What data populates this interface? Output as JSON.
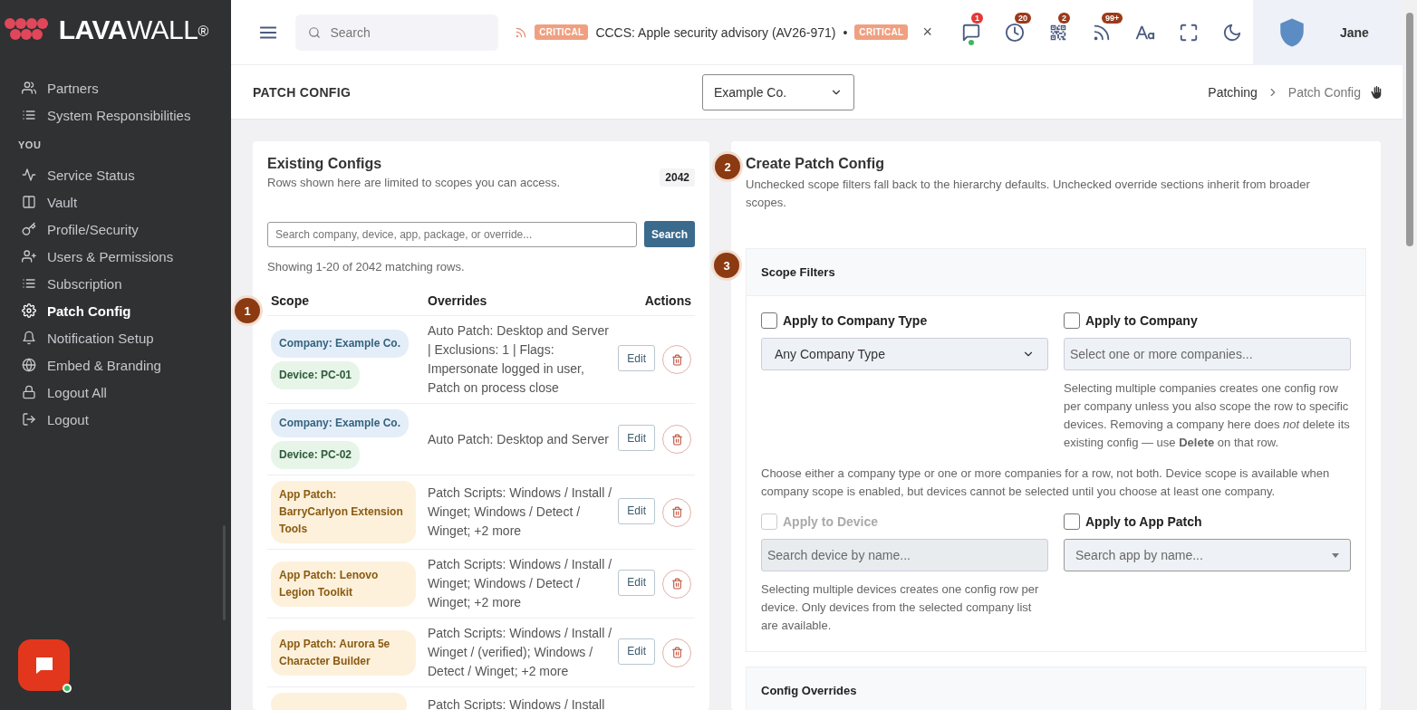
{
  "brand": {
    "bold": "LAVA",
    "light": "WALL",
    "mark": "®"
  },
  "sidebar": {
    "sections": [
      {
        "items": [
          {
            "label": "Partners",
            "selected": false
          },
          {
            "label": "System Responsibilities",
            "selected": false
          }
        ]
      },
      {
        "heading": "YOU",
        "items": [
          {
            "label": "Service Status",
            "selected": false
          },
          {
            "label": "Vault",
            "selected": false
          },
          {
            "label": "Profile/Security",
            "selected": false
          },
          {
            "label": "Users & Permissions",
            "selected": false
          },
          {
            "label": "Subscription",
            "selected": false
          },
          {
            "label": "Patch Config",
            "selected": true
          },
          {
            "label": "Notification Setup",
            "selected": false
          },
          {
            "label": "Embed & Branding",
            "selected": false
          },
          {
            "label": "Logout All",
            "selected": false
          },
          {
            "label": "Logout",
            "selected": false
          }
        ]
      }
    ]
  },
  "topbar": {
    "search": {
      "placeholder": "Search"
    },
    "ticker": [
      {
        "kind": "badge",
        "text": "CRITICAL"
      },
      {
        "kind": "text",
        "text": "CCCS: Apple security advisory (AV26-971)"
      },
      {
        "kind": "separator",
        "text": "•"
      },
      {
        "kind": "badge",
        "text": "CRITICAL"
      }
    ],
    "ticker_close": "×",
    "icons": [
      {
        "kind": "messages",
        "badge": "1",
        "online": true
      },
      {
        "kind": "timer",
        "badge": "20",
        "online": false
      },
      {
        "kind": "qr",
        "badge": "2",
        "online": false
      },
      {
        "kind": "feed",
        "badge": "99+",
        "online": false
      },
      {
        "kind": "font",
        "online": false
      },
      {
        "kind": "fullscreen",
        "online": false
      },
      {
        "kind": "theme",
        "online": false
      }
    ],
    "user": {
      "name": "Jane"
    }
  },
  "page_header": {
    "title": "PATCH CONFIG",
    "company_select": "Example Co.",
    "breadcrumb": [
      {
        "label": "Patching",
        "selected": false
      },
      {
        "label": "Patch Config",
        "selected": true
      }
    ]
  },
  "existing_configs": {
    "step": "1",
    "title": "Existing Configs",
    "subtitle": "Rows shown here are limited to scopes you can access.",
    "count": "2042",
    "search": {
      "placeholder": "Search company, device, app, package, or override...",
      "button": "Search"
    },
    "showing": "Showing 1-20 of 2042 matching rows.",
    "columns": [
      "Scope",
      "Overrides",
      "Actions"
    ],
    "rows": [
      {
        "scope": [
          {
            "kind": "company",
            "text": "Company: Example Co."
          },
          {
            "kind": "device",
            "text": "Device: PC-01"
          }
        ],
        "overrides": "Auto Patch: Desktop and Server | Exclusions: 1 | Flags: Impersonate logged in user, Patch on process close",
        "edit": "Edit"
      },
      {
        "scope": [
          {
            "kind": "company",
            "text": "Company: Example Co."
          },
          {
            "kind": "device",
            "text": "Device: PC-02"
          }
        ],
        "overrides": "Auto Patch: Desktop and Server",
        "edit": "Edit"
      },
      {
        "scope": [
          {
            "kind": "app",
            "text": "App Patch: BarryCarlyon Extension Tools"
          }
        ],
        "overrides": "Patch Scripts: Windows / Install / Winget; Windows / Detect / Winget; +2 more",
        "edit": "Edit"
      },
      {
        "scope": [
          {
            "kind": "app",
            "text": "App Patch: Lenovo Legion Toolkit"
          }
        ],
        "overrides": "Patch Scripts: Windows / Install / Winget; Windows / Detect / Winget; +2 more",
        "edit": "Edit"
      },
      {
        "scope": [
          {
            "kind": "app",
            "text": "App Patch: Aurora 5e Character Builder"
          }
        ],
        "overrides": "Patch Scripts: Windows / Install / Winget / (verified); Windows / Detect / Winget; +2 more",
        "edit": "Edit"
      },
      {
        "scope": [
          {
            "kind": "app"
          }
        ],
        "overrides": "Patch Scripts: Windows / Install"
      }
    ]
  },
  "create_config": {
    "step": "2",
    "title": "Create Patch Config",
    "subtitle": "Unchecked scope filters fall back to the hierarchy defaults. Unchecked override sections inherit from broader scopes.",
    "scope_filters": {
      "step": "3",
      "title": "Scope Filters",
      "company_type": {
        "label": "Apply to Company Type",
        "checked": false,
        "disabled": false,
        "value": "Any Company Type"
      },
      "company": {
        "label": "Apply to Company",
        "checked": false,
        "disabled": false,
        "placeholder": "Select one or more companies...",
        "help": "Selecting multiple companies creates one config row per company unless you also scope the row to specific devices. Removing a company here does *not* delete its existing config — use **Delete** on that row."
      },
      "note": "Choose either a company type or one or more companies for a row, not both. Device scope is available when company scope is enabled, but devices cannot be selected until you choose at least one company.",
      "device": {
        "label": "Apply to Device",
        "checked": false,
        "disabled": true,
        "placeholder": "Search device by name...",
        "help": "Selecting multiple devices creates one config row per device. Only devices from the selected company list are available."
      },
      "app_patch": {
        "label": "Apply to App Patch",
        "checked": false,
        "disabled": false,
        "placeholder": "Search app by name..."
      }
    },
    "config_overrides": {
      "title": "Config Overrides"
    }
  }
}
